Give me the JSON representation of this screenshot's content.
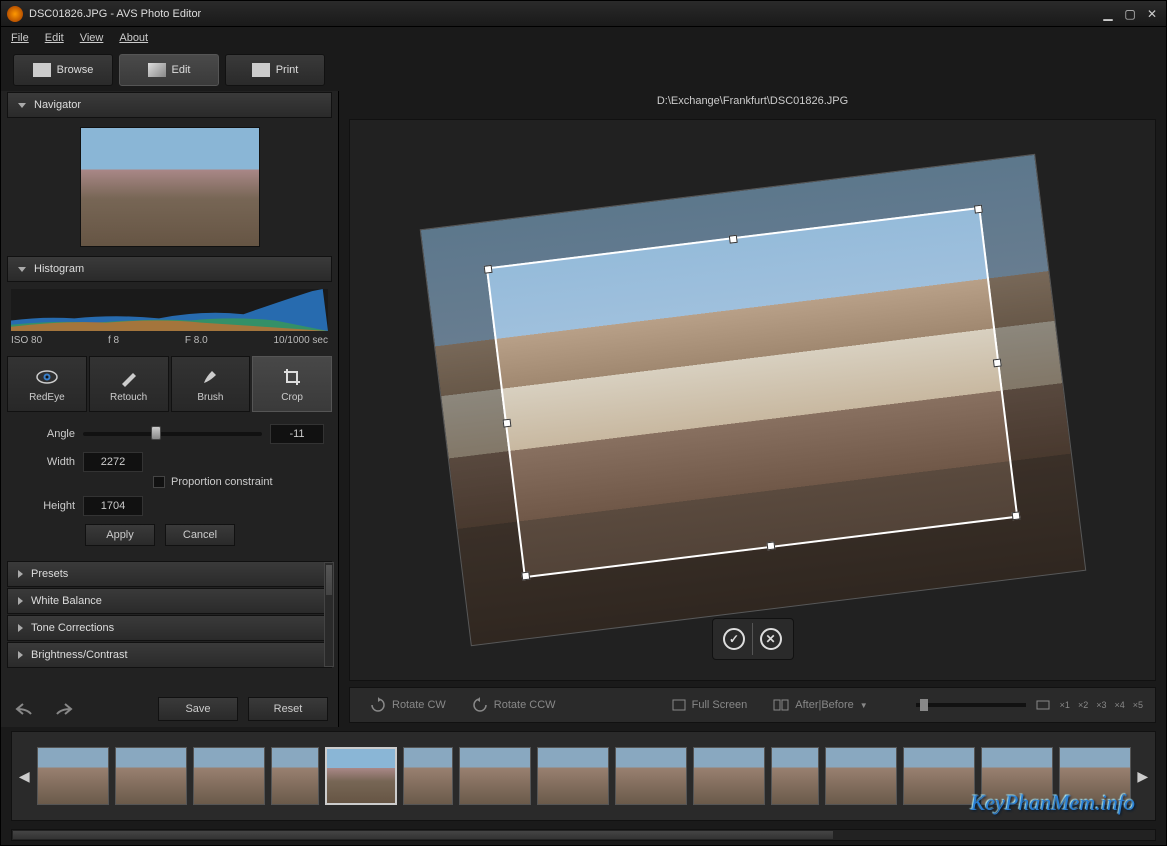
{
  "window": {
    "filename": "DSC01826.JPG",
    "app_name": "AVS Photo Editor",
    "title": "DSC01826.JPG  -  AVS Photo Editor"
  },
  "menu": {
    "file": "File",
    "edit": "Edit",
    "view": "View",
    "about": "About"
  },
  "modes": {
    "browse": "Browse",
    "edit": "Edit",
    "print": "Print"
  },
  "path": "D:\\Exchange\\Frankfurt\\DSC01826.JPG",
  "panels": {
    "navigator": "Navigator",
    "histogram": "Histogram",
    "presets": "Presets",
    "white_balance": "White Balance",
    "tone": "Tone Corrections",
    "brightness": "Brightness/Contrast"
  },
  "histogram_info": {
    "iso": "ISO 80",
    "f_small": "f 8",
    "f_big": "F 8.0",
    "shutter": "10/1000 sec"
  },
  "tools": {
    "redeye": "RedEye",
    "retouch": "Retouch",
    "brush": "Brush",
    "crop": "Crop"
  },
  "crop": {
    "angle_label": "Angle",
    "angle_value": "-11",
    "width_label": "Width",
    "width_value": "2272",
    "height_label": "Height",
    "height_value": "1704",
    "proportion": "Proportion constraint",
    "apply": "Apply",
    "cancel": "Cancel"
  },
  "actions": {
    "save": "Save",
    "reset": "Reset"
  },
  "toolbar": {
    "rotate_cw": "Rotate CW",
    "rotate_ccw": "Rotate CCW",
    "fullscreen": "Full Screen",
    "after_before": "After|Before"
  },
  "zoom": {
    "x1": "×1",
    "x2": "×2",
    "x3": "×3",
    "x4": "×4",
    "x5": "×5"
  },
  "watermark": "KeyPhanMem.info"
}
